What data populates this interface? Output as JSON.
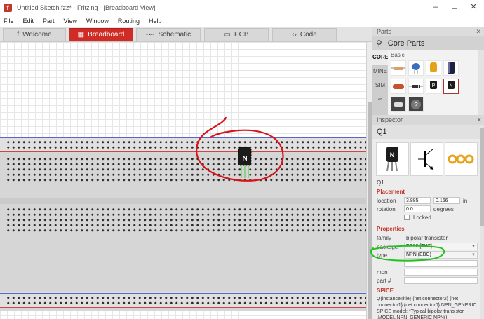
{
  "window": {
    "title": "Untitled Sketch.fzz* - Fritzing - [Breadboard View]",
    "app_icon": "f",
    "controls": {
      "minimize": "–",
      "maximize": "☐",
      "close": "✕"
    }
  },
  "menu": [
    "File",
    "Edit",
    "Part",
    "View",
    "Window",
    "Routing",
    "Help"
  ],
  "tabs": [
    {
      "label": "Welcome",
      "icon": "f"
    },
    {
      "label": "Breadboard",
      "icon": "▦"
    },
    {
      "label": "Schematic",
      "icon": "-⌁-"
    },
    {
      "label": "PCB",
      "icon": "▭"
    },
    {
      "label": "Code",
      "icon": "‹›"
    }
  ],
  "canvas": {
    "part_letter": "N"
  },
  "parts": {
    "dock_title": "Parts",
    "search_label": "Core Parts",
    "bins": [
      "CORE",
      "MINE",
      "SIM",
      "∞"
    ],
    "section": "Basic",
    "close": "✕"
  },
  "inspector": {
    "dock_title": "Inspector",
    "close": "✕",
    "title": "Q1",
    "instance": "Q1",
    "placement_header": "Placement",
    "location_label": "location",
    "location_x": "3.885",
    "location_y": "0.166",
    "location_unit": "in",
    "rotation_label": "rotation",
    "rotation_value": "0.0",
    "rotation_unit": "degrees",
    "locked_label": "Locked",
    "properties_header": "Properties",
    "family_label": "family",
    "family_value": "bipolar transistor",
    "package_label": "package",
    "package_value": "TO92 [THT]",
    "type_label": "type",
    "type_value": "NPN (EBC)",
    "mpn_label": "mpn",
    "part_label": "part #",
    "spice_header": "SPICE",
    "spice_text": "Q{instanceTitle} {net connector2} {net connector1} {net connector0} NPN_GENERIC SPICE model: *Typical bipolar transistor .MODEL NPN_GENERIC NPN()"
  },
  "colors": {
    "active_tab": "#d02b25",
    "annotation_red": "#d8141b",
    "annotation_green": "#22c21e",
    "section_red": "#c0392b"
  }
}
